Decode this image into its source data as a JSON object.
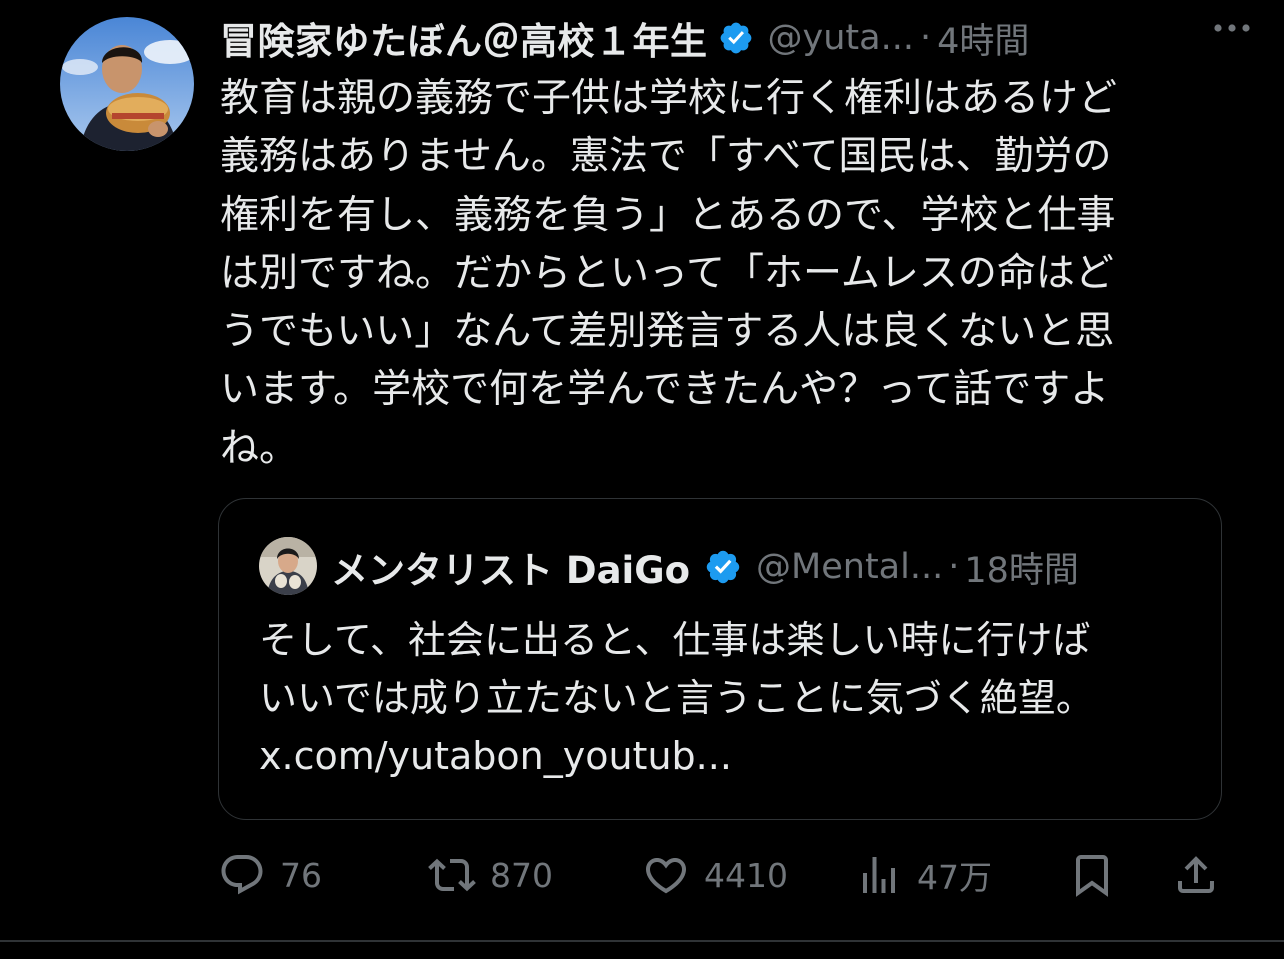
{
  "tweet": {
    "display_name": "冒険家ゆたぼん＠高校１年生",
    "handle": "@yuta...",
    "separator": "·",
    "time": "4時間",
    "verified": true,
    "more_icon": "more-icon",
    "body_lines": [
      "教育は親の義務で子供は学校に行く権利はあるけど",
      "義務はありません。憲法で「すべて国民は、勤労の",
      "権利を有し、義務を負う」とあるので、学校と仕事",
      "は別ですね。だからといって「ホームレスの命はど",
      "うでもいい」なんて差別発言する人は良くないと思",
      "います。学校で何を学んできたんや？って話ですよ",
      "ね。"
    ]
  },
  "quote": {
    "display_name": "メンタリスト DaiGo",
    "handle": "@Mental...",
    "separator": "·",
    "time": "18時間",
    "verified": true,
    "body_lines": [
      "そして、社会に出ると、仕事は楽しい時に行けば",
      "いいでは成り立たないと言うことに気づく絶望。",
      "x.com/yutabon_youtub..."
    ]
  },
  "actions": {
    "reply": {
      "icon": "reply-icon",
      "count": "76"
    },
    "retweet": {
      "icon": "retweet-icon",
      "count": "870"
    },
    "like": {
      "icon": "heart-icon",
      "count": "4410"
    },
    "views": {
      "icon": "views-icon",
      "count": "47万"
    },
    "bookmark": {
      "icon": "bookmark-icon"
    },
    "share": {
      "icon": "share-icon"
    }
  },
  "colors": {
    "background": "#000000",
    "text_primary": "#e7e9ea",
    "text_secondary": "#71767b",
    "verified_blue": "#1d9bf0",
    "border": "#2f3336"
  }
}
